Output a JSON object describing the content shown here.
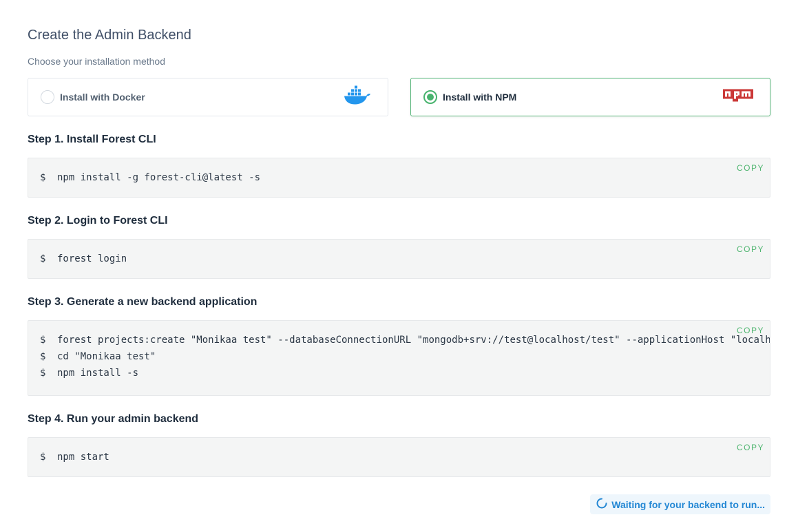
{
  "header": {
    "title": "Create the Admin Backend",
    "subtitle": "Choose your installation method"
  },
  "methods": [
    {
      "label": "Install with Docker",
      "selected": false,
      "icon": "docker-icon"
    },
    {
      "label": "Install with NPM",
      "selected": true,
      "icon": "npm-icon"
    }
  ],
  "copy_label": "COPY",
  "prompt": "$",
  "steps": [
    {
      "title": "Step 1. Install Forest CLI",
      "lines": [
        "npm install -g forest-cli@latest -s"
      ]
    },
    {
      "title": "Step 2. Login to Forest CLI",
      "lines": [
        "forest login"
      ]
    },
    {
      "title": "Step 3. Generate a new backend application",
      "lines": [
        "forest projects:create \"Monikaa test\" --databaseConnectionURL \"mongodb+srv://test@localhost/test\" --applicationHost \"localhost\"",
        "cd \"Monikaa test\"",
        "npm install -s"
      ]
    },
    {
      "title": "Step 4. Run your admin backend",
      "lines": [
        "npm start"
      ]
    }
  ],
  "status": {
    "text": "Waiting for your backend to run...",
    "icon": "spinner-icon"
  },
  "colors": {
    "accent_green": "#48b36e",
    "accent_blue": "#2387d4",
    "npm_red": "#cb3837",
    "docker_blue": "#2396ed"
  }
}
